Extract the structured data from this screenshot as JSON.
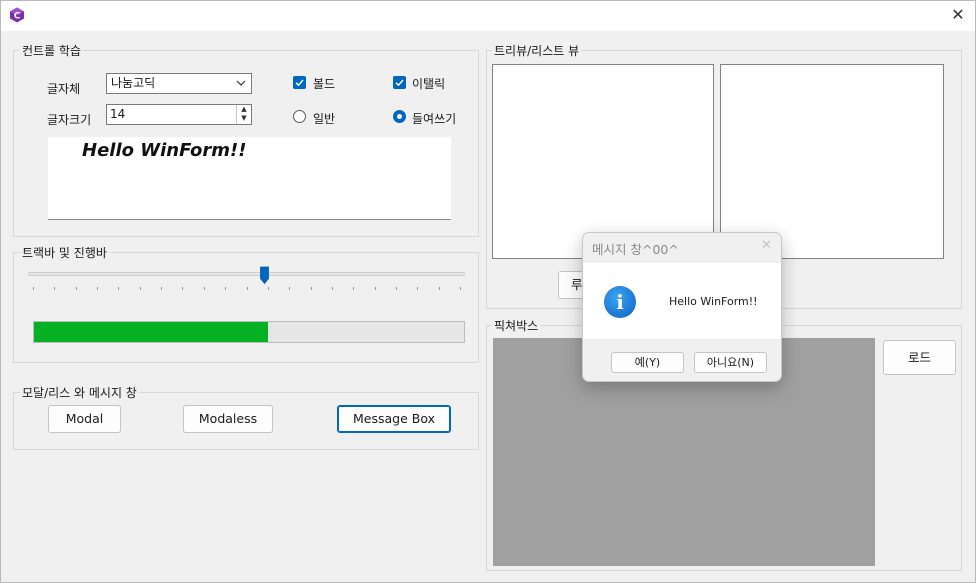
{
  "window": {
    "close_glyph": "✕",
    "app_icon": "csharp-icon"
  },
  "controls_group": {
    "title": "컨트롤 학습",
    "font_label": "글자체",
    "font_value": "나눔고딕",
    "size_label": "글자크기",
    "size_value": "14",
    "bold_label": "볼드",
    "bold_checked": true,
    "italic_label": "이탤릭",
    "italic_checked": true,
    "normal_label": "일반",
    "normal_selected": false,
    "indent_label": "들여쓰기",
    "indent_selected": true,
    "preview_text": "Hello WinForm!!"
  },
  "trackbar_group": {
    "title": "트랙바 및 진행바",
    "trackbar_value_fraction": 0.54,
    "progress_fraction": 0.545
  },
  "modal_group": {
    "title": "모달/리스 와 메시지 창",
    "modal_label": "Modal",
    "modaless_label": "Modaless",
    "messagebox_label": "Message Box"
  },
  "treelist_group": {
    "title": "트리뷰/리스트 뷰",
    "partial_button_label": "루"
  },
  "picture_group": {
    "title": "픽쳐박스",
    "load_label": "로드"
  },
  "dialog": {
    "title": "메시지 창^00^",
    "message": "Hello WinForm!!",
    "yes_label": "예(Y)",
    "no_label": "아니요(N)",
    "close_glyph": "✕",
    "info_glyph": "i"
  },
  "colors": {
    "accent": "#0067c0",
    "progress": "#06b025",
    "picture_bg": "#a0a0a0",
    "window_bg": "#f0f0f0"
  }
}
